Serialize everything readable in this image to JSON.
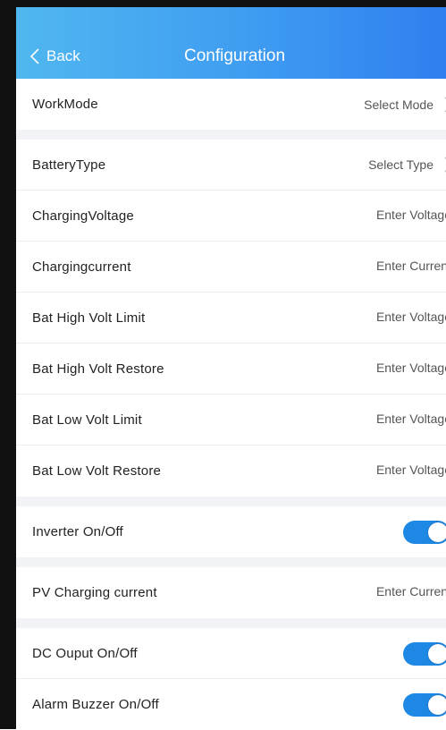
{
  "header": {
    "back_label": "Back",
    "title": "Configuration"
  },
  "colors": {
    "header_start": "#50b7f0",
    "header_end": "#2f7ff0",
    "toggle_on": "#1e88e5"
  },
  "rows": {
    "work_mode": {
      "label": "WorkMode",
      "value": "Select Mode"
    },
    "battery_type": {
      "label": "BatteryType",
      "value": "Select Type"
    },
    "charging_voltage": {
      "label": "ChargingVoltage",
      "placeholder": "Enter Voltage"
    },
    "charging_current": {
      "label": "Chargingcurrent",
      "placeholder": "Enter Current"
    },
    "bat_high_volt_limit": {
      "label": "Bat High Volt Limit",
      "placeholder": "Enter Voltage"
    },
    "bat_high_volt_restore": {
      "label": "Bat High Volt Restore",
      "placeholder": "Enter Voltage"
    },
    "bat_low_volt_limit": {
      "label": "Bat Low Volt Limit",
      "placeholder": "Enter Voltage"
    },
    "bat_low_volt_restore": {
      "label": "Bat Low Volt Restore",
      "placeholder": "Enter Voltage"
    },
    "inverter": {
      "label": "Inverter On/Off",
      "on": true
    },
    "pv_charging_current": {
      "label": "PV Charging current",
      "placeholder": "Enter Current"
    },
    "dc_output": {
      "label": "DC Ouput On/Off",
      "on": true
    },
    "alarm_buzzer": {
      "label": "Alarm Buzzer On/Off",
      "on": true
    }
  },
  "icons": {
    "back": "chevron-left-icon",
    "select": "chevron-right-icon"
  }
}
